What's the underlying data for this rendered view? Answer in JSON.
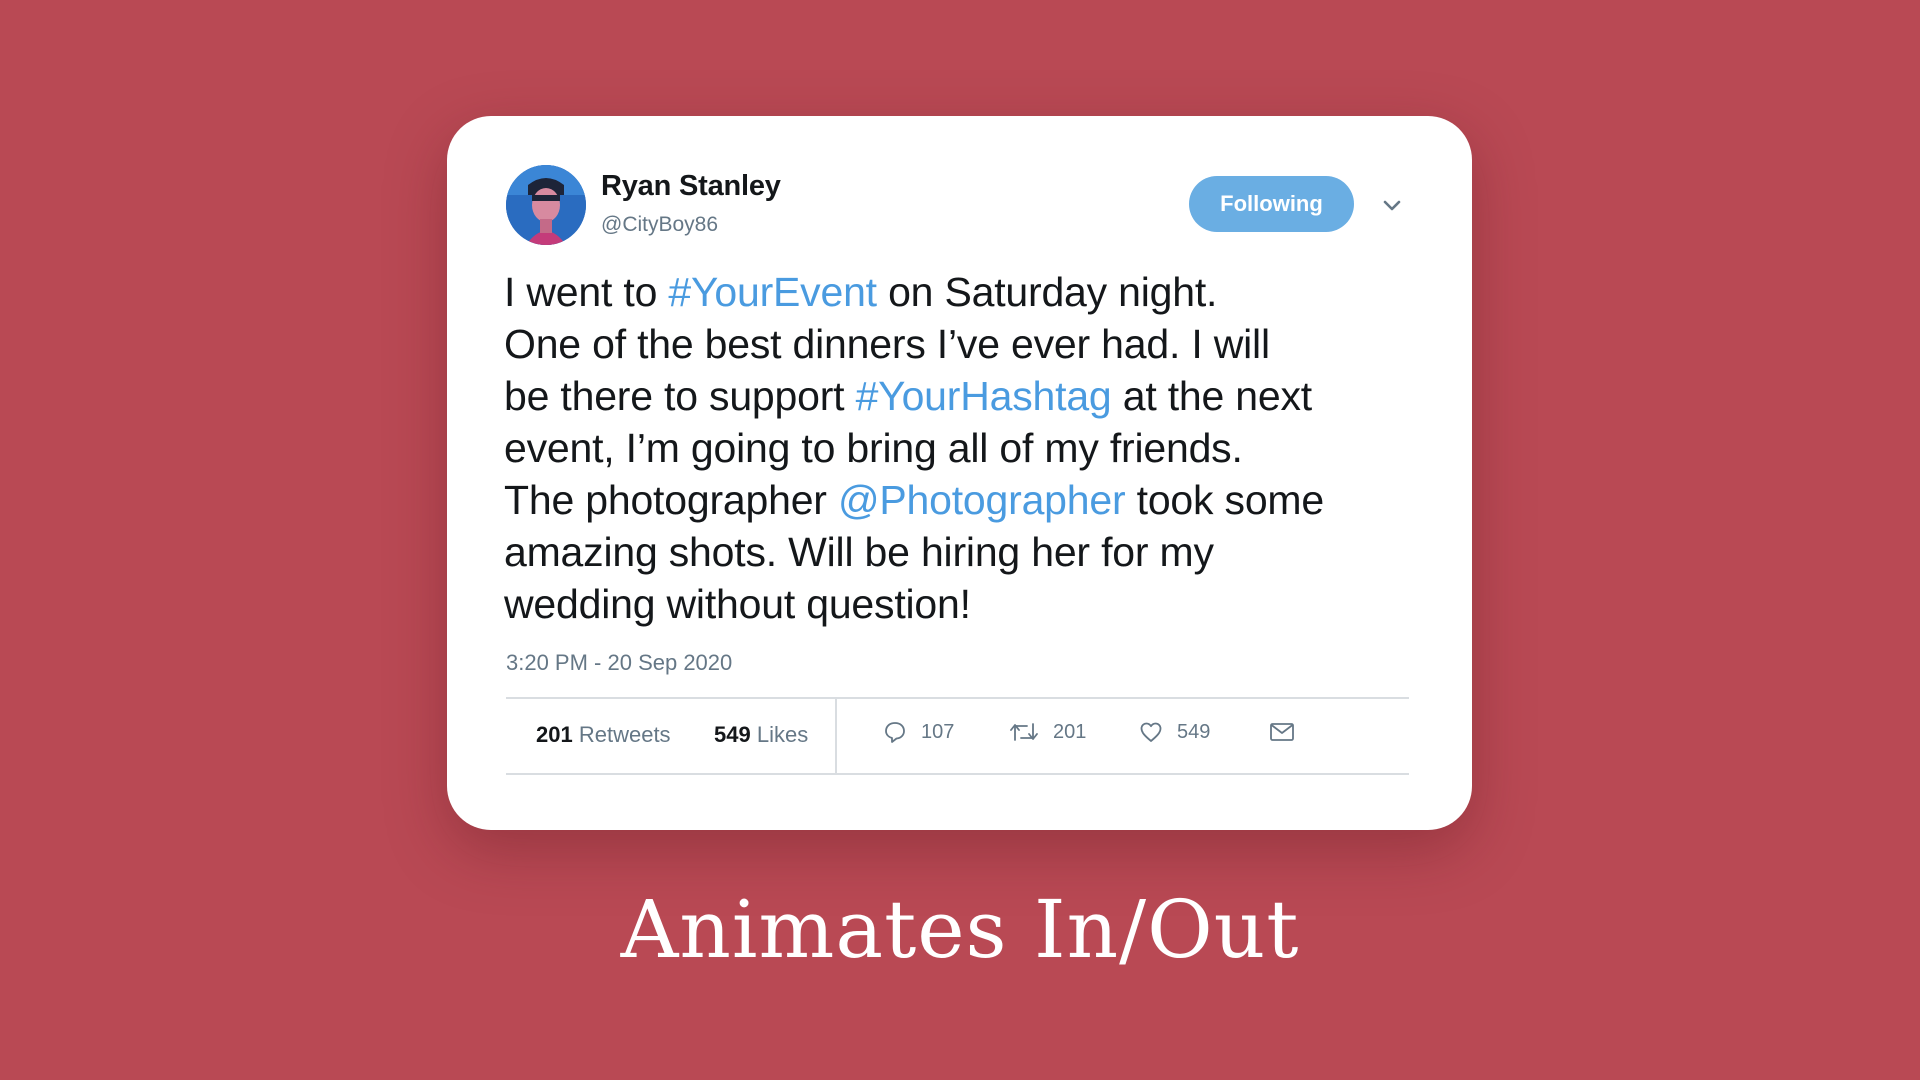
{
  "user": {
    "name": "Ryan Stanley",
    "handle": "@CityBoy86"
  },
  "follow_button": {
    "label": "Following"
  },
  "tweet": {
    "lines": [
      [
        {
          "t": "I went to "
        },
        {
          "t": "#YourEvent",
          "link": true
        },
        {
          "t": " on Saturday night."
        }
      ],
      [
        {
          "t": "One of the best dinners I’ve ever had. I will"
        }
      ],
      [
        {
          "t": "be there to support "
        },
        {
          "t": "#YourHashtag",
          "link": true
        },
        {
          "t": " at the next"
        }
      ],
      [
        {
          "t": "event, I’m going to bring all of my friends."
        }
      ],
      [
        {
          "t": "The photographer "
        },
        {
          "t": "@Photographer",
          "link": true
        },
        {
          "t": " took some"
        }
      ],
      [
        {
          "t": "amazing shots. Will be hiring her for my"
        }
      ],
      [
        {
          "t": "wedding without question!"
        }
      ]
    ],
    "timestamp": "3:20 PM - 20 Sep 2020"
  },
  "stats": {
    "retweets_count": "201",
    "retweets_label": "Retweets",
    "likes_count": "549",
    "likes_label": "Likes"
  },
  "actions": {
    "reply_count": "107",
    "retweet_count": "201",
    "like_count": "549"
  },
  "icons": {
    "reply": "reply-icon",
    "retweet": "retweet-icon",
    "like": "heart-icon",
    "message": "envelope-icon",
    "more": "chevron-down-icon"
  },
  "colors": {
    "background": "#b94954",
    "link": "#4a9be0",
    "follow_button": "#6aaee3"
  },
  "caption": "Animates In/Out"
}
